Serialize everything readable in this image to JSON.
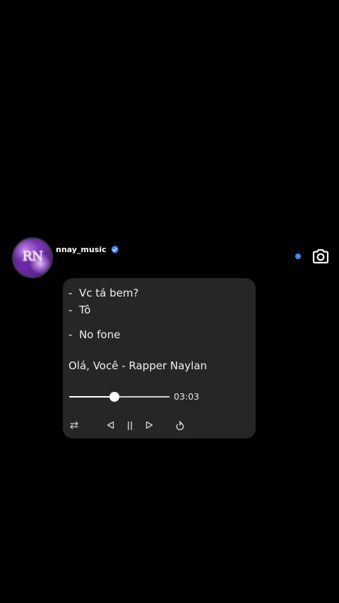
{
  "post": {
    "username": "nnay_music",
    "avatar_monogram": "RN",
    "verified": true,
    "accent_color": "#3d8bff"
  },
  "card": {
    "lines": [
      "-  Vc tá bem?",
      "-  Tô",
      "-  No fone"
    ],
    "song_title": "Olá, Você - Rapper Naylan",
    "player": {
      "duration": "03:03",
      "progress_fraction": 0.45
    }
  },
  "icons": {
    "verified": "verified-badge-icon",
    "camera": "camera-icon",
    "repeat": "repeat-icon",
    "previous": "previous-icon",
    "pause": "pause-icon",
    "next": "next-icon",
    "replay": "replay-icon"
  }
}
